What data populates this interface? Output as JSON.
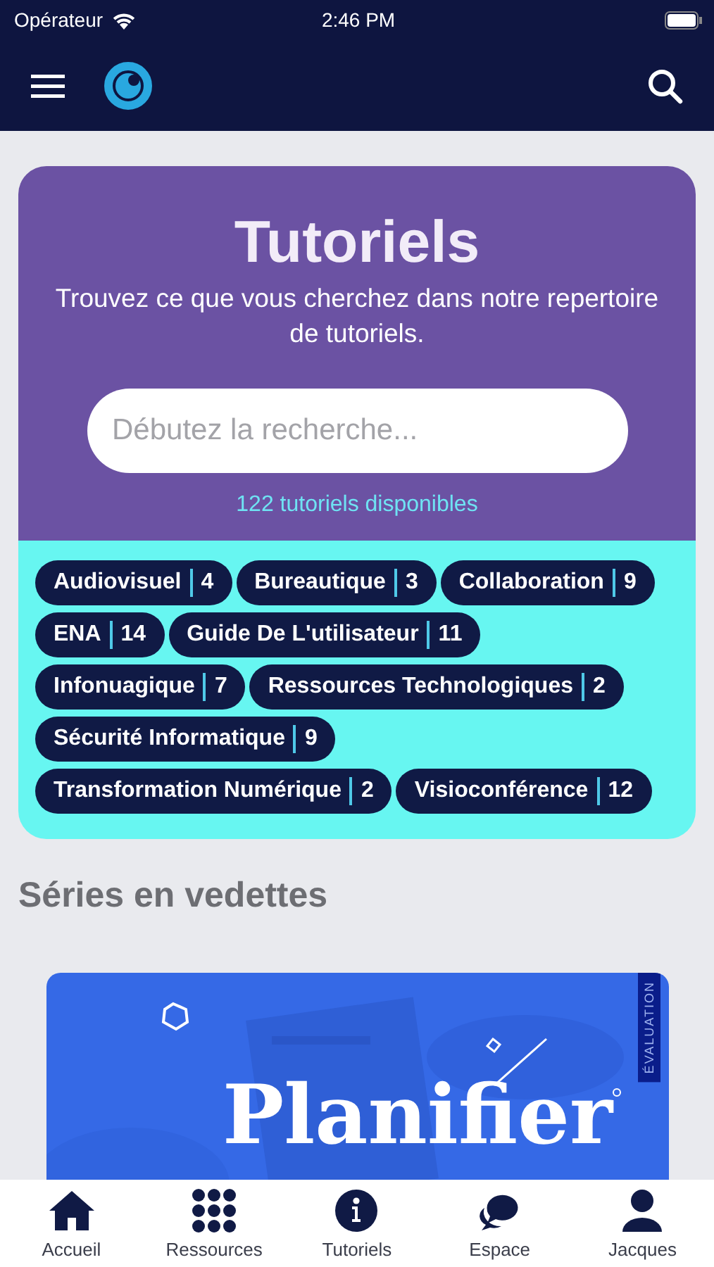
{
  "status_bar": {
    "carrier": "Opérateur",
    "time": "2:46 PM"
  },
  "hero": {
    "title": "Tutoriels",
    "subtitle": "Trouvez ce que vous cherchez dans notre repertoire de tutoriels.",
    "search": {
      "placeholder": "Débutez la recherche..."
    },
    "count": "122 tutoriels disponibles"
  },
  "categories": [
    {
      "label": "Audiovisuel",
      "count": "4"
    },
    {
      "label": "Bureautique",
      "count": "3"
    },
    {
      "label": "Collaboration",
      "count": "9"
    },
    {
      "label": "ENA",
      "count": "14"
    },
    {
      "label": "Guide De L'utilisateur",
      "count": "11"
    },
    {
      "label": "Infonuagique",
      "count": "7"
    },
    {
      "label": "Ressources Technologiques",
      "count": "2"
    },
    {
      "label": "Sécurité Informatique",
      "count": "9"
    },
    {
      "label": "Transformation Numérique",
      "count": "2"
    },
    {
      "label": "Visioconférence",
      "count": "12"
    }
  ],
  "featured": {
    "heading": "Séries en vedettes",
    "card": {
      "kind": "picture",
      "tag": "ÉVALUATION",
      "title": "Planifier"
    }
  },
  "tab_bar": [
    {
      "label": "Accueil"
    },
    {
      "label": "Ressources"
    },
    {
      "label": "Tutoriels"
    },
    {
      "label": "Espace"
    },
    {
      "label": "Jacques"
    }
  ]
}
